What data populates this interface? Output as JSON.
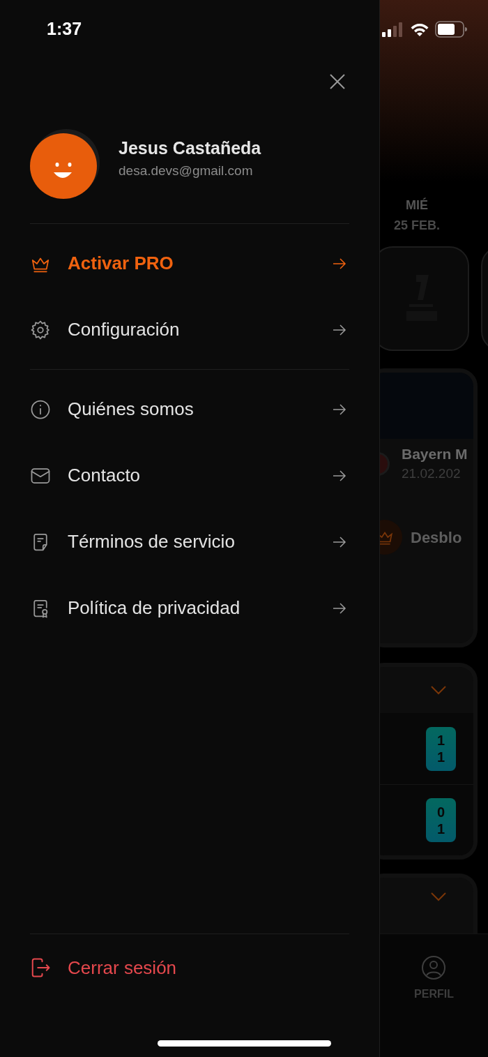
{
  "status_bar": {
    "time": "1:37"
  },
  "profile": {
    "name": "Jesus Castañeda",
    "email": "desa.devs@gmail.com"
  },
  "menu_groups": [
    [
      {
        "label": "Activar PRO",
        "kind": "pro"
      },
      {
        "label": "Configuración",
        "kind": "link"
      }
    ],
    [
      {
        "label": "Quiénes somos",
        "kind": "link"
      },
      {
        "label": "Contacto",
        "kind": "link"
      },
      {
        "label": "Términos de servicio",
        "kind": "link"
      },
      {
        "label": "Política de privacidad",
        "kind": "link"
      }
    ]
  ],
  "logout": {
    "label": "Cerrar sesión"
  },
  "background": {
    "day": {
      "weekday": "MIÉ",
      "date": "25 FEB."
    },
    "match": {
      "team": "Bayern M",
      "date": "21.02.202"
    },
    "promo": "Desblo",
    "scores": [
      {
        "home": "1",
        "away": "1"
      },
      {
        "home": "0",
        "away": "1"
      }
    ],
    "nav_label": "PERFIL"
  }
}
